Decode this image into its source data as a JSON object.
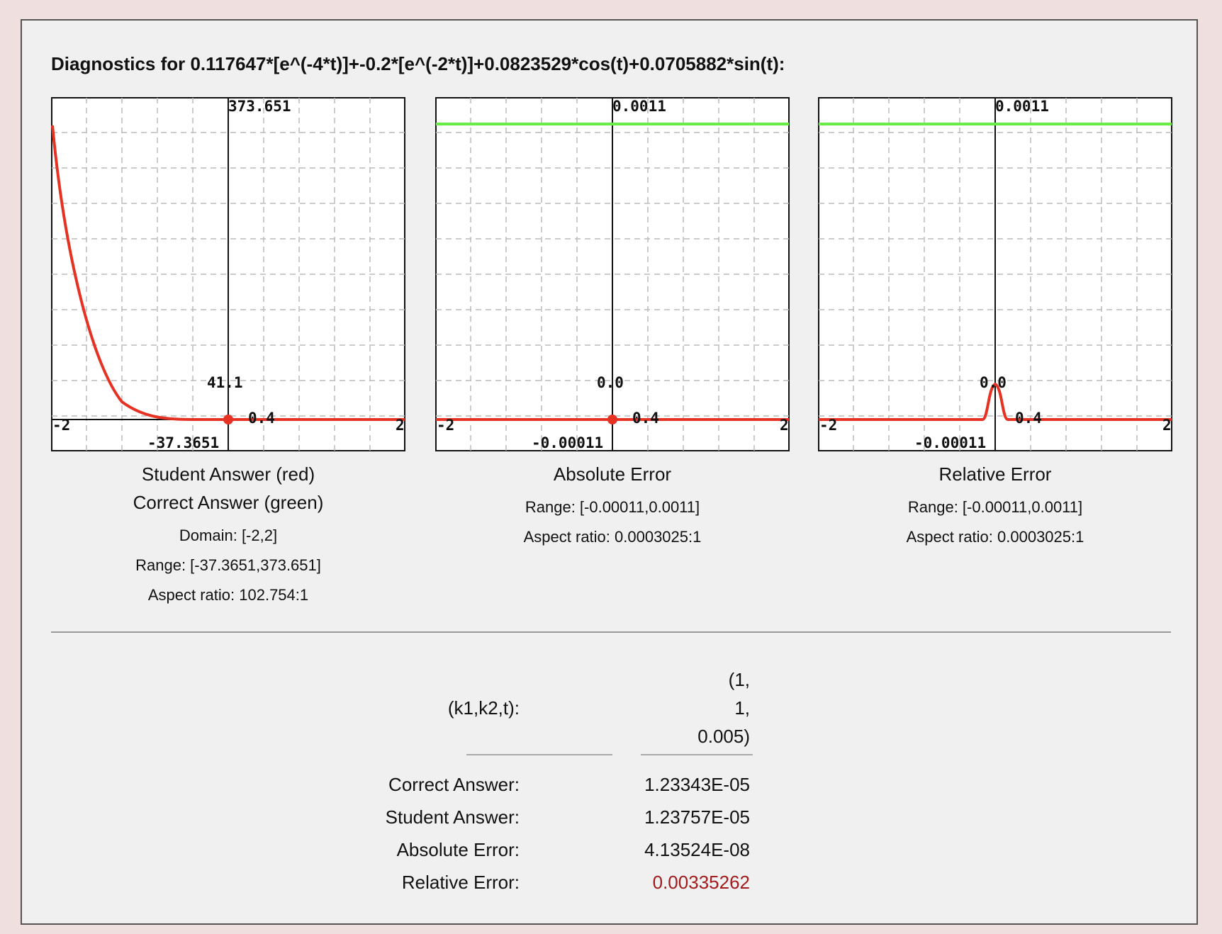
{
  "title": "Diagnostics for 0.117647*[e^(-4*t)]+-0.2*[e^(-2*t)]+0.0823529*cos(t)+0.0705882*sin(t):",
  "colors": {
    "student": "#e53223",
    "correct": "#66ee44",
    "relative_error_value": "#a11c1c"
  },
  "plots": [
    {
      "labels": {
        "top": "373.651",
        "bottom": "-37.3651",
        "x_left": "-2",
        "x_right": "2",
        "mid_y": "41.1",
        "mid_x": "0.4"
      },
      "caption_lines": [
        "Student Answer (red)",
        "Correct Answer (green)"
      ],
      "info_lines": [
        "Domain: [-2,2]",
        "Range: [-37.3651,373.651]",
        "Aspect ratio: 102.754:1"
      ]
    },
    {
      "labels": {
        "top": "0.0011",
        "bottom": "-0.00011",
        "x_left": "-2",
        "x_right": "2",
        "mid_y": "0.0",
        "mid_x": "0.4"
      },
      "caption_lines": [
        "Absolute Error"
      ],
      "info_lines": [
        "Range: [-0.00011,0.0011]",
        "Aspect ratio: 0.0003025:1"
      ]
    },
    {
      "labels": {
        "top": "0.0011",
        "bottom": "-0.00011",
        "x_left": "-2",
        "x_right": "2",
        "mid_y": "0.0",
        "mid_x": "0.4"
      },
      "caption_lines": [
        "Relative Error"
      ],
      "info_lines": [
        "Range: [-0.00011,0.0011]",
        "Aspect ratio: 0.0003025:1"
      ]
    }
  ],
  "table": {
    "header_label": "(k1,k2,t):",
    "header_value_lines": [
      "(1,",
      "1,",
      "0.005)"
    ],
    "rows": [
      {
        "label": "Correct Answer:",
        "value": "1.23343E-05"
      },
      {
        "label": "Student Answer:",
        "value": "1.23757E-05"
      },
      {
        "label": "Absolute Error:",
        "value": "4.13524E-08"
      },
      {
        "label": "Relative Error:",
        "value": "0.00335262"
      }
    ]
  }
}
